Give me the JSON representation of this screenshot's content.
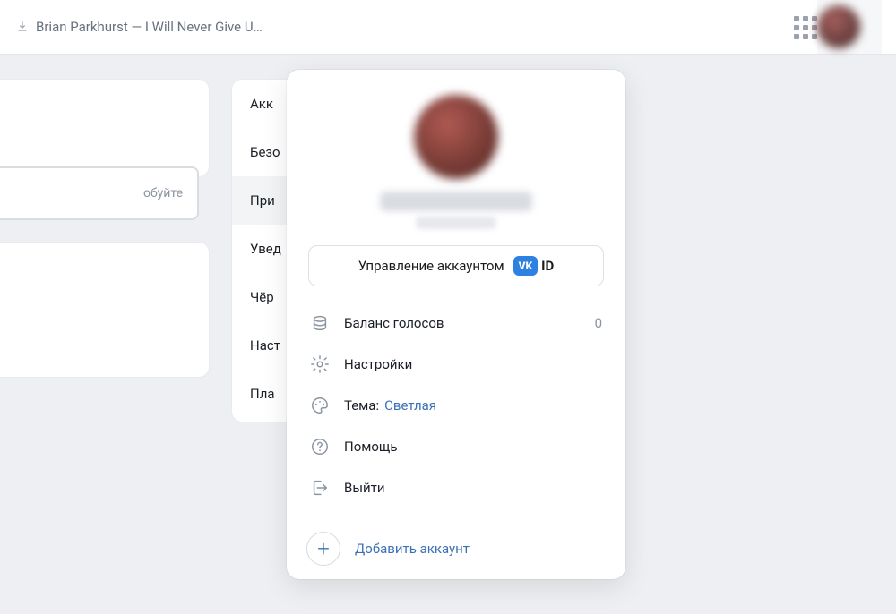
{
  "topbar": {
    "track_text": "Brian Parkhurst — I Will Never Give U…"
  },
  "left": {
    "try_text": "обуйте"
  },
  "settings_tabs": [
    "Акк",
    "Безо",
    "При",
    "Увед",
    "Чёр",
    "Наст",
    "Пла"
  ],
  "menu": {
    "manage_label": "Управление аккаунтом",
    "vkid_chip": "VK",
    "vkid_id": "ID",
    "balance": {
      "label": "Баланс голосов",
      "value": "0"
    },
    "settings_label": "Настройки",
    "theme": {
      "label": "Тема:",
      "value": "Светлая"
    },
    "help_label": "Помощь",
    "logout_label": "Выйти",
    "add_label": "Добавить аккаунт"
  }
}
